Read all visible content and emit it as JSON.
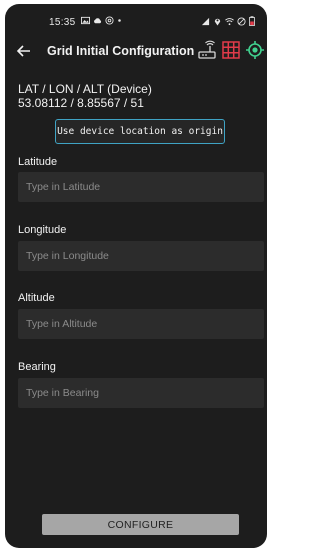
{
  "status_bar": {
    "time": "15:35",
    "left_icons": [
      "gallery-icon",
      "cloud-icon",
      "mail-icon",
      "dot-icon"
    ],
    "right_icons": [
      "signal-icon",
      "location-icon",
      "wifi-icon",
      "dnd-icon",
      "battery-icon"
    ]
  },
  "app_bar": {
    "title": "Grid Initial Configuration",
    "actions": [
      {
        "icon": "router-icon",
        "color": "#d9d9d9"
      },
      {
        "icon": "grid-icon",
        "color": "#e23b4a"
      },
      {
        "icon": "gps-target-icon",
        "color": "#41d18f"
      }
    ]
  },
  "device": {
    "label": "LAT / LON / ALT (Device)",
    "value": "53.08112 / 8.85567 / 51"
  },
  "origin_button": {
    "label": "Use device location as origin"
  },
  "fields": [
    {
      "label": "Latitude",
      "placeholder": "Type in Latitude"
    },
    {
      "label": "Longitude",
      "placeholder": "Type in Longitude"
    },
    {
      "label": "Altitude",
      "placeholder": "Type in Altitude"
    },
    {
      "label": "Bearing",
      "placeholder": "Type in Bearing"
    }
  ],
  "configure_button": {
    "label": "CONFIGURE"
  },
  "colors": {
    "background": "#1d1d1d",
    "field_background": "#2c2c2c",
    "accent_outline": "#3fa3c4",
    "button_background": "#a6a6a6"
  }
}
